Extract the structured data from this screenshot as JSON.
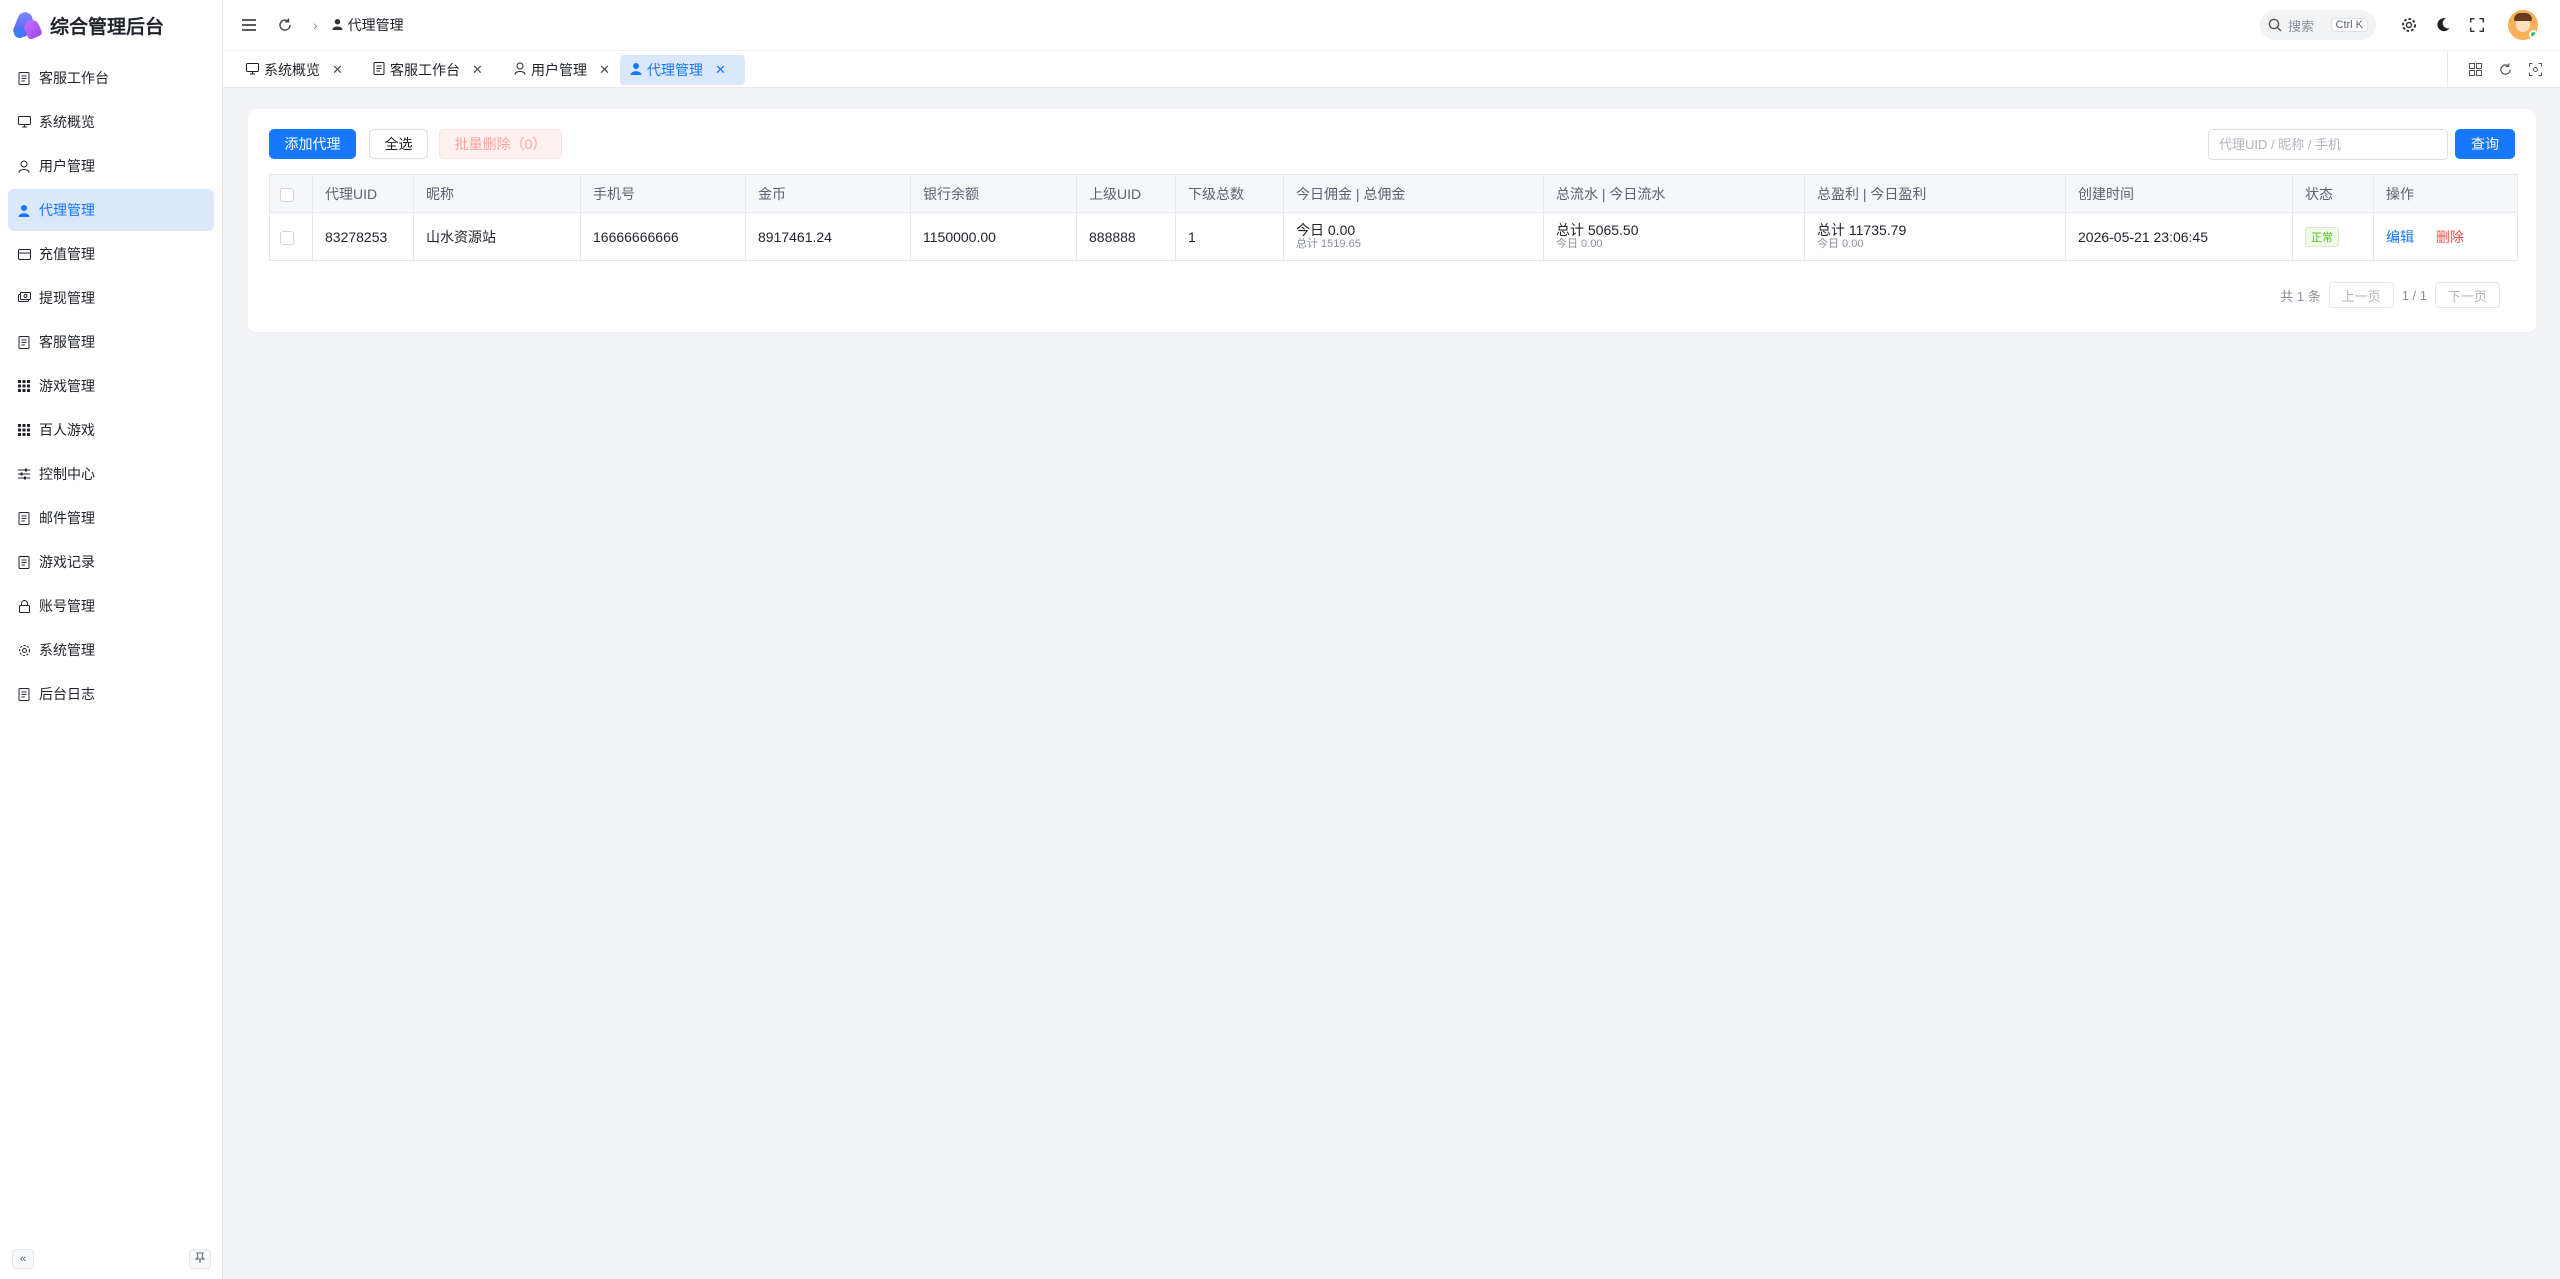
{
  "app": {
    "title": "综合管理后台"
  },
  "sidebar": {
    "items": [
      {
        "label": "客服工作台",
        "icon": "document-icon"
      },
      {
        "label": "系统概览",
        "icon": "monitor-icon"
      },
      {
        "label": "用户管理",
        "icon": "user-icon"
      },
      {
        "label": "代理管理",
        "icon": "user-solid-icon",
        "active": true
      },
      {
        "label": "充值管理",
        "icon": "card-icon"
      },
      {
        "label": "提现管理",
        "icon": "cash-icon"
      },
      {
        "label": "客服管理",
        "icon": "document-icon"
      },
      {
        "label": "游戏管理",
        "icon": "grid-icon"
      },
      {
        "label": "百人游戏",
        "icon": "grid-icon"
      },
      {
        "label": "控制中心",
        "icon": "sliders-icon"
      },
      {
        "label": "邮件管理",
        "icon": "document-icon"
      },
      {
        "label": "游戏记录",
        "icon": "document-icon"
      },
      {
        "label": "账号管理",
        "icon": "lock-icon"
      },
      {
        "label": "系统管理",
        "icon": "gear-icon"
      },
      {
        "label": "后台日志",
        "icon": "document-icon"
      }
    ]
  },
  "header": {
    "breadcrumb": "代理管理",
    "search": {
      "label": "搜索",
      "shortcut": "Ctrl K"
    }
  },
  "tabs": [
    {
      "label": "系统概览",
      "icon": "monitor-icon"
    },
    {
      "label": "客服工作台",
      "icon": "document-icon"
    },
    {
      "label": "用户管理",
      "icon": "user-icon"
    },
    {
      "label": "代理管理",
      "icon": "user-solid-icon",
      "active": true
    }
  ],
  "toolbar": {
    "add_label": "添加代理",
    "select_all_label": "全选",
    "batch_delete_label": "批量删除（0）",
    "search_placeholder": "代理UID / 昵称 / 手机",
    "query_label": "查询"
  },
  "table": {
    "columns": [
      "代理UID",
      "昵称",
      "手机号",
      "金币",
      "银行余额",
      "上级UID",
      "下级总数",
      "今日佣金 | 总佣金",
      "总流水 | 今日流水",
      "总盈利 | 今日盈利",
      "创建时间",
      "状态",
      "操作"
    ],
    "rows": [
      {
        "uid": "83278253",
        "nickname": "山水资源站",
        "phone": "16666666666",
        "coins": "8917461.24",
        "bank": "1150000.00",
        "parent_uid": "888888",
        "children": "1",
        "commission_main": "今日 0.00",
        "commission_sub": "总计 1519.65",
        "flow_main": "总计 5065.50",
        "flow_sub": "今日 0.00",
        "profit_main": "总计 11735.79",
        "profit_sub": "今日 0.00",
        "created": "2026-05-21 23:06:45",
        "status": "正常",
        "edit": "编辑",
        "delete": "删除"
      }
    ]
  },
  "pagination": {
    "total": "共 1 条",
    "prev": "上一页",
    "page": "1 / 1",
    "next": "下一页"
  },
  "colors": {
    "primary": "#1677ff",
    "active_bg": "#dbe8fc",
    "danger": "#ff4d4f",
    "success": "#52c41a"
  }
}
